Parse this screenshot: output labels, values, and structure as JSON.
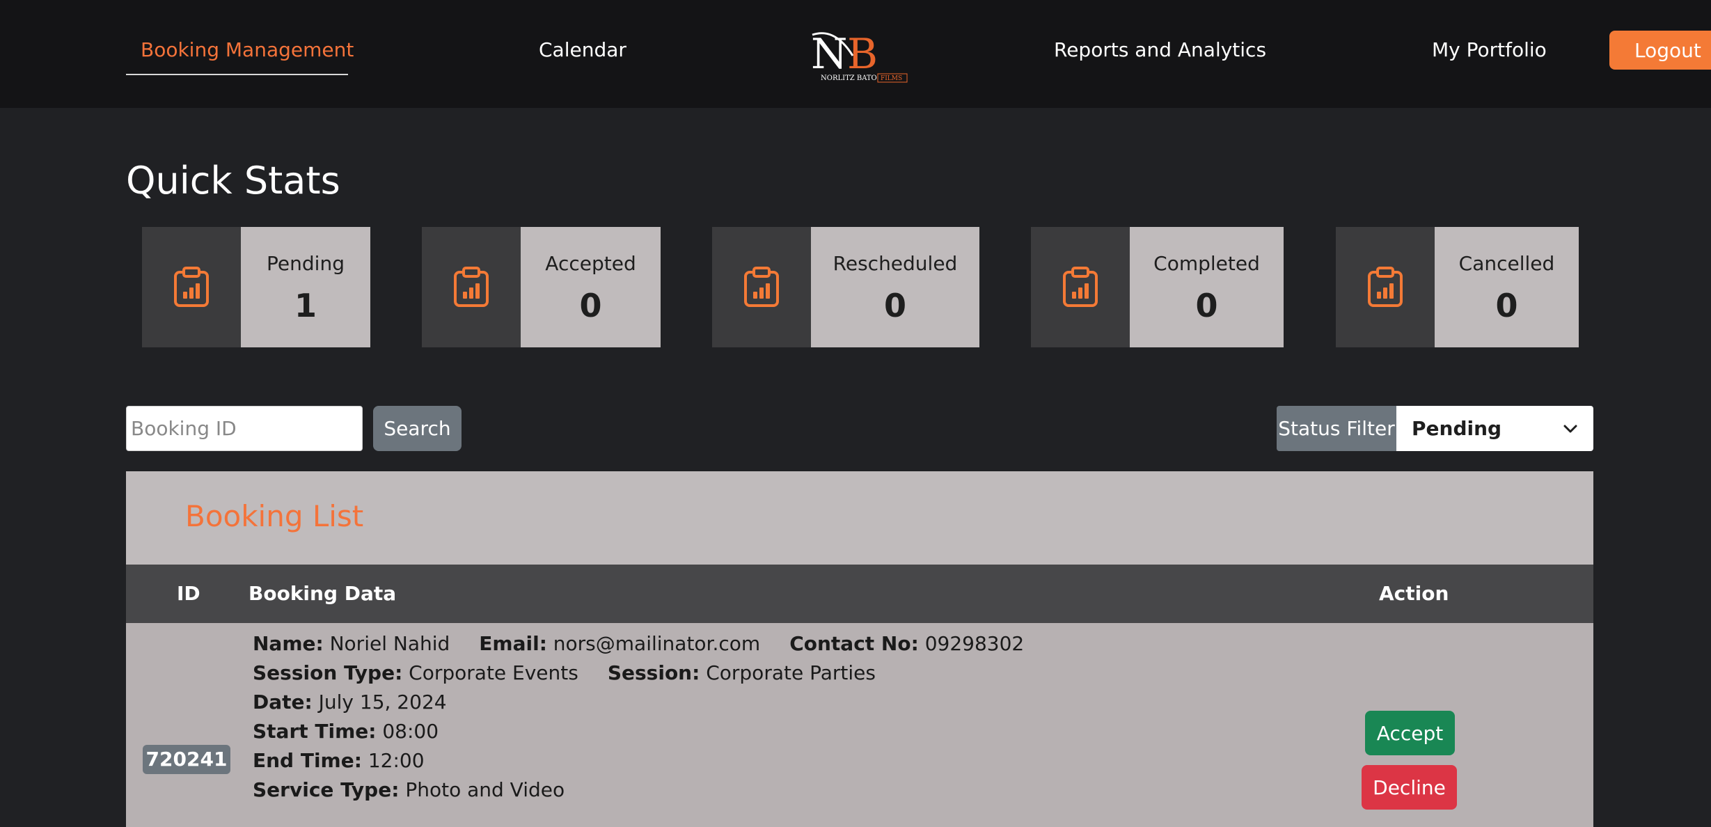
{
  "nav": {
    "items": [
      {
        "label": "Booking Management",
        "active": true
      },
      {
        "label": "Calendar",
        "active": false
      },
      {
        "label": "Reports and Analytics",
        "active": false
      },
      {
        "label": "My Portfolio",
        "active": false
      }
    ],
    "logo": {
      "letters": "NB",
      "tagline": "NORLITZ BATO",
      "tagline_box": "FILMS"
    },
    "logout_label": "Logout"
  },
  "quick_stats": {
    "title": "Quick Stats",
    "icon": "clipboard-chart-icon",
    "cards": [
      {
        "label": "Pending",
        "value": "1"
      },
      {
        "label": "Accepted",
        "value": "0"
      },
      {
        "label": "Rescheduled",
        "value": "0"
      },
      {
        "label": "Completed",
        "value": "0"
      },
      {
        "label": "Cancelled",
        "value": "0"
      }
    ]
  },
  "search": {
    "placeholder": "Booking ID",
    "button_label": "Search"
  },
  "filter": {
    "label": "Status Filter",
    "selected": "Pending"
  },
  "booking_list": {
    "title": "Booking List",
    "columns": [
      "ID",
      "Booking Data",
      "Action"
    ],
    "rows": [
      {
        "id": "720241",
        "fields": {
          "name_label": "Name:",
          "name": "Noriel Nahid",
          "email_label": "Email:",
          "email": "nors@mailinator.com",
          "contact_label": "Contact No:",
          "contact": "09298302",
          "session_type_label": "Session Type:",
          "session_type": "Corporate Events",
          "session_label": "Session:",
          "session": "Corporate Parties",
          "date_label": "Date:",
          "date": "July 15, 2024",
          "start_label": "Start Time:",
          "start": "08:00",
          "end_label": "End Time:",
          "end": "12:00",
          "service_label": "Service Type:",
          "service": "Photo and Video"
        },
        "actions": {
          "accept": "Accept",
          "decline": "Decline"
        }
      }
    ]
  },
  "colors": {
    "accent": "#f4733a",
    "navbar_bg": "#141416",
    "page_bg": "#202124",
    "card_bg": "#c0bbbc",
    "accept": "#198754",
    "decline": "#dc3545"
  }
}
